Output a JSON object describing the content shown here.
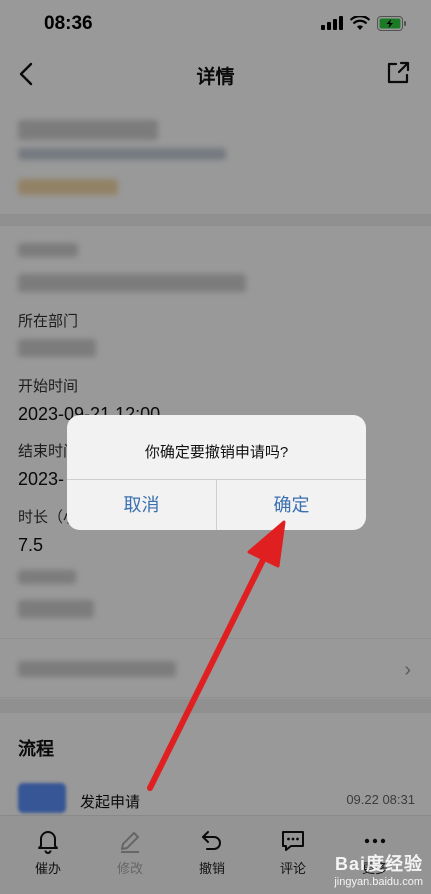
{
  "status_bar": {
    "time": "08:36"
  },
  "nav": {
    "title": "详情"
  },
  "fields": [
    {
      "label": "所在部门",
      "value": ""
    },
    {
      "label": "开始时间",
      "value": "2023-09-21 12:00"
    },
    {
      "label": "结束时间",
      "value": "2023-"
    },
    {
      "label": "时长（小",
      "value": "7.5"
    }
  ],
  "flow": {
    "title": "流程",
    "step": "发起申请",
    "time": "09.22 08:31"
  },
  "bottom_bar": {
    "items": [
      {
        "label": "催办",
        "icon": "bell-icon"
      },
      {
        "label": "修改",
        "icon": "pencil-icon"
      },
      {
        "label": "撤销",
        "icon": "undo-icon"
      },
      {
        "label": "评论",
        "icon": "comment-icon"
      },
      {
        "label": "更多",
        "icon": "more-icon"
      }
    ]
  },
  "dialog": {
    "message": "你确定要撤销申请吗?",
    "cancel_label": "取消",
    "confirm_label": "确定"
  },
  "watermark": {
    "main": "Bai度经验",
    "sub": "jingyan.baidu.com"
  },
  "colors": {
    "dialog_button": "#3a6fb0",
    "annotation_arrow": "#e02020"
  }
}
